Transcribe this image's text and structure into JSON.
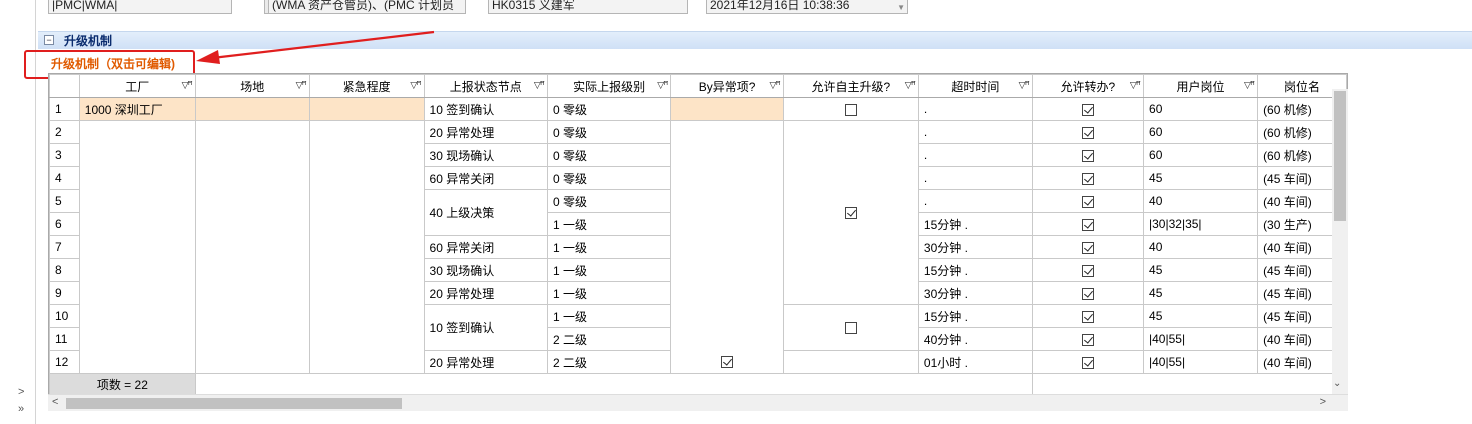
{
  "filters": {
    "role_codes": "|PMC|WMA|",
    "role_names": "(WMA 资产仓管员)、(PMC 计划员",
    "doc_no": "HK0315 义建军",
    "datetime": "2021年12月16日 10:38:36"
  },
  "section": {
    "title": "升级机制",
    "toggle": "−"
  },
  "edit_hint": "升级机制（双击可编辑)",
  "columns": [
    {
      "label": "工厂"
    },
    {
      "label": "场地"
    },
    {
      "label": "紧急程度"
    },
    {
      "label": "上报状态节点"
    },
    {
      "label": "实际上报级别"
    },
    {
      "label": "By异常项?"
    },
    {
      "label": "允许自主升级?"
    },
    {
      "label": "超时时间"
    },
    {
      "label": "允许转办?"
    },
    {
      "label": "用户岗位"
    },
    {
      "label": "岗位名"
    }
  ],
  "filter_icon": "▽ꟸ",
  "factory": "1000 深圳工厂",
  "rows": [
    {
      "n": "1",
      "node": "10 签到确认",
      "level": "0 零级",
      "timeout": ".",
      "post": "60",
      "post_name": "(60 机修)"
    },
    {
      "n": "2",
      "node": "20 异常处理",
      "level": "0 零级",
      "timeout": ".",
      "post": "60",
      "post_name": "(60 机修)"
    },
    {
      "n": "3",
      "node": "30 现场确认",
      "level": "0 零级",
      "timeout": ".",
      "post": "60",
      "post_name": "(60 机修)"
    },
    {
      "n": "4",
      "node": "60 异常关闭",
      "level": "0 零级",
      "timeout": ".",
      "post": "45",
      "post_name": "(45 车间)"
    },
    {
      "n": "5",
      "node": "40 上级决策",
      "level": "0 零级",
      "timeout": ".",
      "post": "40",
      "post_name": "(40 车间)"
    },
    {
      "n": "6",
      "node": "",
      "level": "1 一级",
      "timeout": "15分钟 .",
      "post": "|30|32|35|",
      "post_name": "(30 生产)"
    },
    {
      "n": "7",
      "node": "60 异常关闭",
      "level": "1 一级",
      "timeout": "30分钟 .",
      "post": "40",
      "post_name": "(40 车间)"
    },
    {
      "n": "8",
      "node": "30 现场确认",
      "level": "1 一级",
      "timeout": "15分钟 .",
      "post": "45",
      "post_name": "(45 车间)"
    },
    {
      "n": "9",
      "node": "20 异常处理",
      "level": "1 一级",
      "timeout": "30分钟 .",
      "post": "45",
      "post_name": "(45 车间)"
    },
    {
      "n": "10",
      "node": "10 签到确认",
      "level": "1 一级",
      "timeout": "15分钟 .",
      "post": "45",
      "post_name": "(45 车间)"
    },
    {
      "n": "11",
      "node": "",
      "level": "2 二级",
      "timeout": "40分钟 .",
      "post": "|40|55|",
      "post_name": "(40 车间)"
    },
    {
      "n": "12",
      "node": "20 异常处理",
      "level": "2 二级",
      "timeout": "01小时         .",
      "post": "|40|55|",
      "post_name": "(40 车间)"
    }
  ],
  "footer": {
    "count_label": "项数 = 22"
  },
  "left_nav": {
    "expand": ">",
    "collapse": "»"
  },
  "scroll": {
    "down": "⌄",
    "left": "<",
    "right": ">"
  }
}
